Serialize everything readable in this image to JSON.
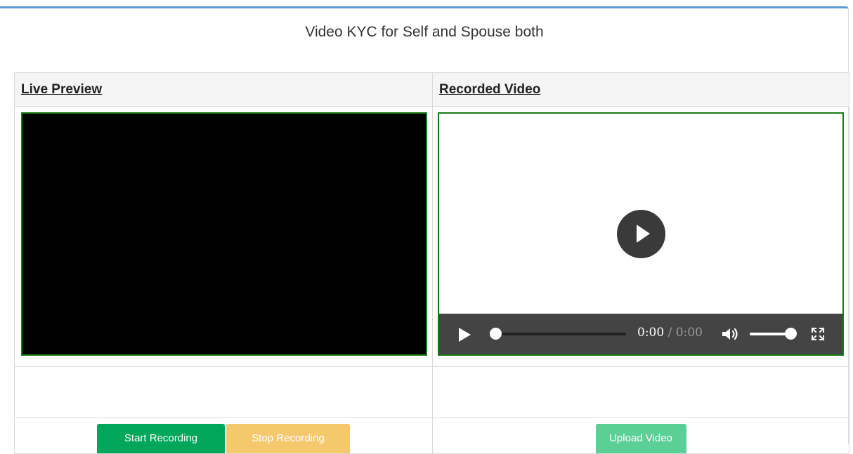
{
  "panel": {
    "title": "Video KYC for Self and Spouse both"
  },
  "columns": {
    "live_preview": "Live Preview",
    "recorded_video": "Recorded Video"
  },
  "player": {
    "current_time": "0:00",
    "separator": "/",
    "duration": "0:00",
    "progress": 0,
    "volume": 1
  },
  "buttons": {
    "start_recording": "Start Recording",
    "stop_recording": "Stop Recording",
    "upload_video": "Upload Video"
  },
  "colors": {
    "accent_top": "#5b9bd5",
    "video_border": "#1a7a1a",
    "start_button": "#00a65a",
    "stop_button": "#f6c86e",
    "upload_button": "#5ccf97"
  },
  "icons": {
    "big_play": "play-circle-icon",
    "play": "play-icon",
    "volume": "volume-icon",
    "fullscreen": "fullscreen-icon"
  }
}
